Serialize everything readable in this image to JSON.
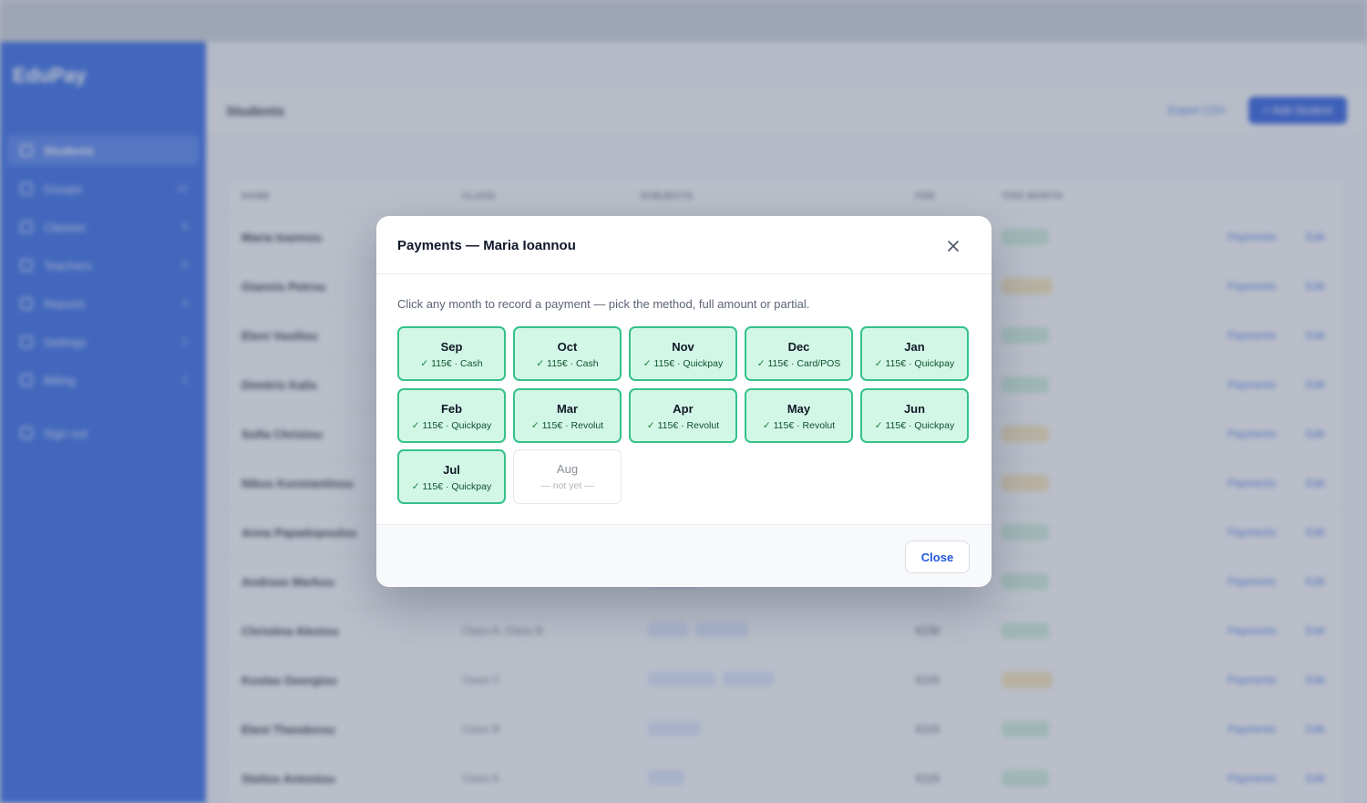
{
  "modal": {
    "title": "Payments — Maria Ioannou",
    "hint": "Click any month to record a payment — pick the method, full amount or partial.",
    "close_label": "Close",
    "months": [
      {
        "month": "Sep",
        "detail": "115€ · Cash",
        "status": "paid"
      },
      {
        "month": "Oct",
        "detail": "115€ · Cash",
        "status": "paid"
      },
      {
        "month": "Nov",
        "detail": "115€ · Quickpay",
        "status": "paid"
      },
      {
        "month": "Dec",
        "detail": "115€ · Card/POS",
        "status": "paid"
      },
      {
        "month": "Jan",
        "detail": "115€ · Quickpay",
        "status": "paid"
      },
      {
        "month": "Feb",
        "detail": "115€ · Quickpay",
        "status": "paid"
      },
      {
        "month": "Mar",
        "detail": "115€ · Revolut",
        "status": "paid"
      },
      {
        "month": "Apr",
        "detail": "115€ · Revolut",
        "status": "paid"
      },
      {
        "month": "May",
        "detail": "115€ · Revolut",
        "status": "paid"
      },
      {
        "month": "Jun",
        "detail": "115€ · Quickpay",
        "status": "paid"
      },
      {
        "month": "Jul",
        "detail": "115€ · Quickpay",
        "status": "paid"
      },
      {
        "month": "Aug",
        "detail": "— not yet —",
        "status": "empty"
      }
    ],
    "check_glyph": "✓"
  },
  "colors": {
    "sidebar": "#2a63e6",
    "primary": "#2457e0",
    "paid_bg": "#d3f7e6",
    "paid_border": "#35c28a"
  },
  "background": {
    "sidebar": {
      "brand": "EduPay",
      "nav": [
        {
          "label": "Students",
          "active": true
        },
        {
          "label": "Groups",
          "count": "12"
        },
        {
          "label": "Classes",
          "count": "8"
        },
        {
          "label": "Teachers",
          "count": "6"
        },
        {
          "label": "Reports",
          "count": "4"
        },
        {
          "label": "Settings",
          "count": "2"
        },
        {
          "label": "Billing",
          "count": "1"
        },
        {
          "label": "Sign out"
        }
      ]
    },
    "header": {
      "title": "Students",
      "export_label": "Export CSV",
      "add_label": "+ Add Student"
    },
    "table": {
      "columns": [
        "NAME",
        "CLASS",
        "SUBJECTS",
        "FEE",
        "THIS MONTH"
      ],
      "rows": [
        {
          "name": "Maria Ioannou",
          "status": "paid",
          "action": "Payments",
          "edit": "Edit"
        },
        {
          "name": "Giannis Petrou",
          "status": "partial",
          "action": "Payments",
          "edit": "Edit"
        },
        {
          "name": "Eleni Vasiliou",
          "status": "paid",
          "action": "Payments",
          "edit": "Edit"
        },
        {
          "name": "Dimitris Kalis",
          "status": "paid",
          "action": "Payments",
          "edit": "Edit"
        },
        {
          "name": "Sofia Christou",
          "status": "unpaid",
          "action": "Payments",
          "edit": "Edit"
        },
        {
          "name": "Nikos Konstantinou",
          "status": "unpaid",
          "action": "Payments",
          "edit": "Edit"
        },
        {
          "name": "Anna Papadopoulou",
          "status": "paid",
          "action": "Payments",
          "edit": "Edit"
        },
        {
          "name": "Andreas Markou",
          "status": "paid",
          "action": "Payments",
          "edit": "Edit"
        },
        {
          "name": "Christina Alexiou",
          "class": "Class A, Class B",
          "fee": "€230",
          "status": "paid",
          "action": "Payments",
          "edit": "Edit"
        },
        {
          "name": "Kostas Georgiou",
          "class": "Class C",
          "fee": "€115",
          "status": "partial",
          "action": "Payments",
          "edit": "Edit"
        },
        {
          "name": "Eleni Theodorou",
          "class": "Class B",
          "fee": "€115",
          "status": "paid",
          "action": "Payments",
          "edit": "Edit"
        },
        {
          "name": "Stelios Antoniou",
          "class": "Class A",
          "fee": "€115",
          "status": "paid",
          "action": "Payments",
          "edit": "Edit"
        }
      ]
    }
  }
}
